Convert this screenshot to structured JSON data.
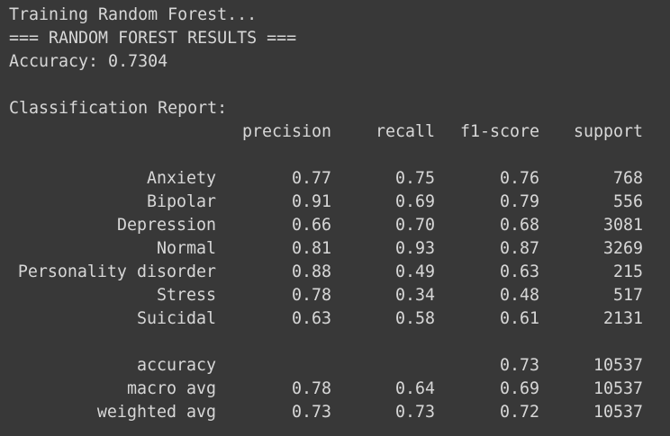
{
  "output": {
    "status_line": "Training Random Forest...",
    "results_header": "=== RANDOM FOREST RESULTS ===",
    "accuracy_line": "Accuracy: 0.7304",
    "report_title": "Classification Report:"
  },
  "report": {
    "headers": {
      "precision": "precision",
      "recall": "recall",
      "f1": "f1-score",
      "support": "support"
    },
    "classes": [
      {
        "label": "Anxiety",
        "precision": "0.77",
        "recall": "0.75",
        "f1": "0.76",
        "support": "768"
      },
      {
        "label": "Bipolar",
        "precision": "0.91",
        "recall": "0.69",
        "f1": "0.79",
        "support": "556"
      },
      {
        "label": "Depression",
        "precision": "0.66",
        "recall": "0.70",
        "f1": "0.68",
        "support": "3081"
      },
      {
        "label": "Normal",
        "precision": "0.81",
        "recall": "0.93",
        "f1": "0.87",
        "support": "3269"
      },
      {
        "label": "Personality disorder",
        "precision": "0.88",
        "recall": "0.49",
        "f1": "0.63",
        "support": "215"
      },
      {
        "label": "Stress",
        "precision": "0.78",
        "recall": "0.34",
        "f1": "0.48",
        "support": "517"
      },
      {
        "label": "Suicidal",
        "precision": "0.63",
        "recall": "0.58",
        "f1": "0.61",
        "support": "2131"
      }
    ],
    "summary": [
      {
        "label": "accuracy",
        "precision": "",
        "recall": "",
        "f1": "0.73",
        "support": "10537"
      },
      {
        "label": "macro avg",
        "precision": "0.78",
        "recall": "0.64",
        "f1": "0.69",
        "support": "10537"
      },
      {
        "label": "weighted avg",
        "precision": "0.73",
        "recall": "0.73",
        "f1": "0.72",
        "support": "10537"
      }
    ]
  },
  "colors": {
    "background": "#383838",
    "text": "#d7d7d7"
  }
}
